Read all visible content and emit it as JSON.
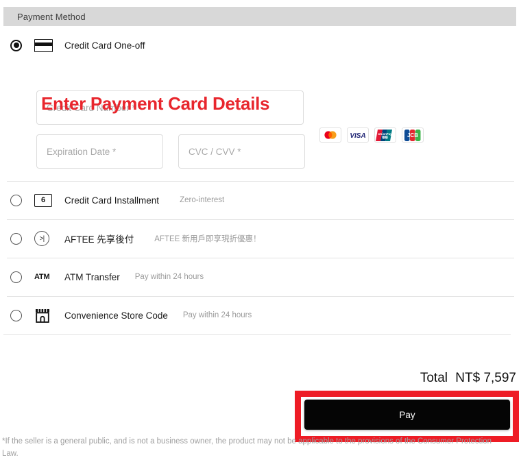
{
  "header": {
    "title": "Payment Method"
  },
  "annotations": {
    "card_details_heading": "Enter Payment Card Details",
    "highlight_color": "#ee1c25"
  },
  "payment_options": [
    {
      "id": "credit-card-one-off",
      "label": "Credit Card One-off",
      "note": "",
      "icon": "credit-card-icon",
      "selected": true
    },
    {
      "id": "credit-card-installment",
      "label": "Credit Card Installment",
      "note": "Zero-interest",
      "icon": "installment-6-badge-icon",
      "badge_text": "6",
      "selected": false
    },
    {
      "id": "aftee",
      "label": "AFTEE 先享後付",
      "note": "AFTEE 新用戶即享現折優惠！",
      "icon": "aftee-icon",
      "selected": false
    },
    {
      "id": "atm-transfer",
      "label": "ATM Transfer",
      "note": "Pay within 24 hours",
      "icon": "atm-icon",
      "badge_text": "ATM",
      "selected": false
    },
    {
      "id": "convenience-store-code",
      "label": "Convenience Store Code",
      "note": "Pay within 24 hours",
      "icon": "store-icon",
      "selected": false
    }
  ],
  "card_form": {
    "card_number_placeholder": "Credit Card Number *",
    "expiration_placeholder": "Expiration Date *",
    "cvc_placeholder": "CVC / CVV *",
    "card_number_value": "",
    "expiration_value": "",
    "cvc_value": "",
    "accepted_brands": [
      {
        "name": "mastercard-logo",
        "label": "Mastercard"
      },
      {
        "name": "visa-logo",
        "label": "VISA"
      },
      {
        "name": "unionpay-logo",
        "label": "UnionPay"
      },
      {
        "name": "jcb-logo",
        "label": "JCB"
      }
    ]
  },
  "summary": {
    "total_label": "Total",
    "total_amount": "NT$ 7,597",
    "pay_button_label": "Pay"
  },
  "footer": {
    "disclaimer": "*If the seller is a general public, and is not a business owner, the product may not be applicable to the provisions of the Consumer Protection Law."
  }
}
